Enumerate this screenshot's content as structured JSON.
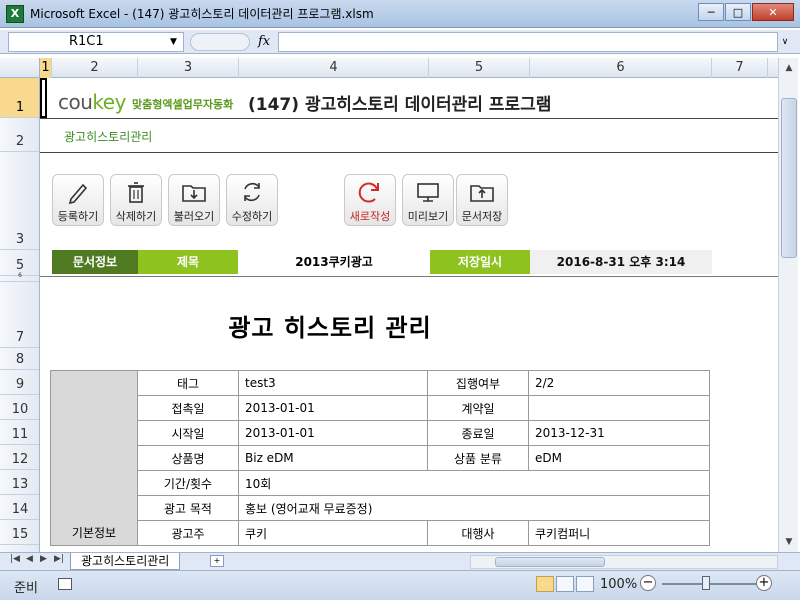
{
  "window": {
    "title": "Microsoft Excel - (147) 광고히스토리 데이터관리 프로그램.xlsm",
    "app_icon": "excel-icon",
    "minimize": "─",
    "maximize": "□",
    "close": "✕"
  },
  "formula_bar": {
    "name_box": "R1C1",
    "fx": "fx",
    "formula": ""
  },
  "columns": [
    "1",
    "2",
    "3",
    "4",
    "5",
    "6",
    "7"
  ],
  "rows": [
    "1",
    "2",
    "3",
    "5",
    "6",
    "7",
    "8",
    "9",
    "10",
    "11",
    "12",
    "13",
    "14",
    "15"
  ],
  "header": {
    "logo_part1": "cou",
    "logo_part2": "key",
    "logo_tagline": "맞춤형엑셀업무자동화",
    "program_title": "(147) 광고히스토리 데이터관리 프로그램",
    "subtitle": "광고히스토리관리"
  },
  "toolbar": {
    "register": "등록하기",
    "delete": "삭제하기",
    "load": "불러오기",
    "edit": "수정하기",
    "new": "새로작성",
    "preview": "미리보기",
    "save": "문서저장"
  },
  "doc_info": {
    "label": "문서정보",
    "title_label": "제목",
    "title_value": "2013쿠키광고",
    "saved_label": "저장일시",
    "saved_value": "2016-8-31 오후 3:14"
  },
  "form": {
    "heading": "광고 히스토리 관리",
    "group_label": "기본정보",
    "rows": [
      {
        "l1": "태그",
        "v1": "test3",
        "l2": "집행여부",
        "v2": "2/2"
      },
      {
        "l1": "접촉일",
        "v1": "2013-01-01",
        "l2": "계약일",
        "v2": ""
      },
      {
        "l1": "시작일",
        "v1": "2013-01-01",
        "l2": "종료일",
        "v2": "2013-12-31"
      },
      {
        "l1": "상품명",
        "v1": "Biz eDM",
        "l2": "상품 분류",
        "v2": "eDM"
      },
      {
        "l1": "기간/횟수",
        "v1": "10회"
      },
      {
        "l1": "광고 목적",
        "v1": "홍보 (영어교재 무료증정)"
      },
      {
        "l1": "광고주",
        "v1": "쿠키",
        "l2": "대행사",
        "v2": "쿠키컴퍼니"
      }
    ]
  },
  "sheet_tabs": {
    "active": "광고히스토리관리"
  },
  "status": {
    "ready": "준비",
    "zoom": "100%"
  }
}
